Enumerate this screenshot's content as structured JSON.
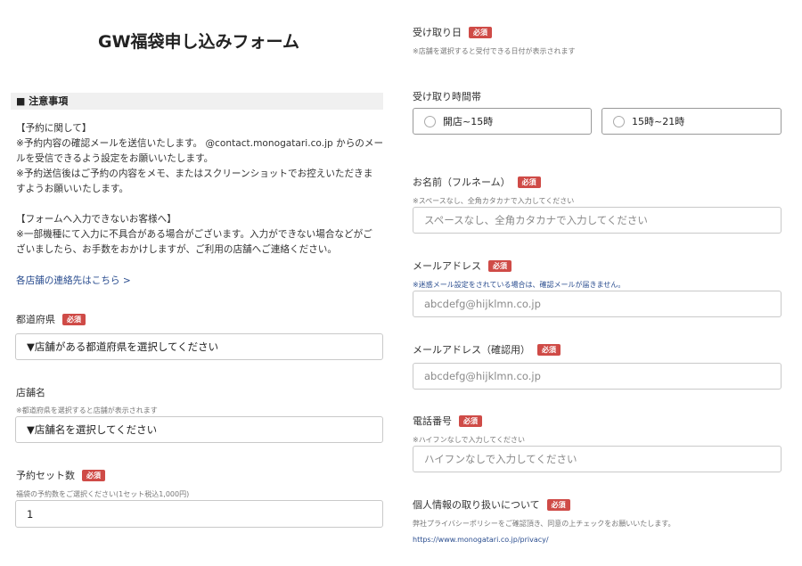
{
  "form_title": "GW福袋申し込みフォーム",
  "notice": {
    "heading": "■ 注意事項",
    "lines": [
      "【予約に関して】",
      "※予約内容の確認メールを送信いたします。 @contact.monogatari.co.jp からのメー",
      "ルを受信できるよう設定をお願いいたします。",
      "※予約送信後はご予約の内容をメモ、またはスクリーンショットでお控えいただきま",
      "すようお願いいたします。",
      "",
      "【フォームへ入力できないお客様へ】",
      "※一部機種にて入力に不具合がある場合がございます。入力ができない場合などがご",
      "ざいましたら、お手数をおかけしますが、ご利用の店舗へご連絡ください。"
    ],
    "contact_link": "各店舗の連絡先はこちら >"
  },
  "required_badge": "必須",
  "prefecture": {
    "label": "都道府県",
    "selected": "▼店舗がある都道府県を選択してください"
  },
  "store": {
    "label": "店舗名",
    "hint": "※都道府県を選択すると店舗が表示されます",
    "selected": "▼店舗名を選択してください"
  },
  "set_count": {
    "label": "予約セット数",
    "hint": "福袋の予約数をご選択ください(1セット税込1,000円)",
    "value": "1"
  },
  "pickup_date": {
    "label": "受け取り日",
    "hint": "※店舗を選択すると受付できる日付が表示されます"
  },
  "pickup_time": {
    "label": "受け取り時間帯",
    "options": [
      "開店~15時",
      "15時~21時"
    ]
  },
  "name": {
    "label": "お名前（フルネーム）",
    "hint": "※スペースなし、全角カタカナで入力してください",
    "placeholder": "スペースなし、全角カタカナで入力してください"
  },
  "email": {
    "label": "メールアドレス",
    "hint": "※迷惑メール設定をされている場合は、確認メールが届きません。",
    "placeholder": "abcdefg@hijklmn.co.jp"
  },
  "email_confirm": {
    "label": "メールアドレス（確認用）",
    "placeholder": "abcdefg@hijklmn.co.jp"
  },
  "phone": {
    "label": "電話番号",
    "hint": "※ハイフンなしで入力してください",
    "placeholder": "ハイフンなしで入力してください"
  },
  "privacy": {
    "label": "個人情報の取り扱いについて",
    "text": "弊社プライバシーポリシーをご確認頂き、同意の上チェックをお願いいたします。",
    "link": "https://www.monogatari.co.jp/privacy/"
  }
}
